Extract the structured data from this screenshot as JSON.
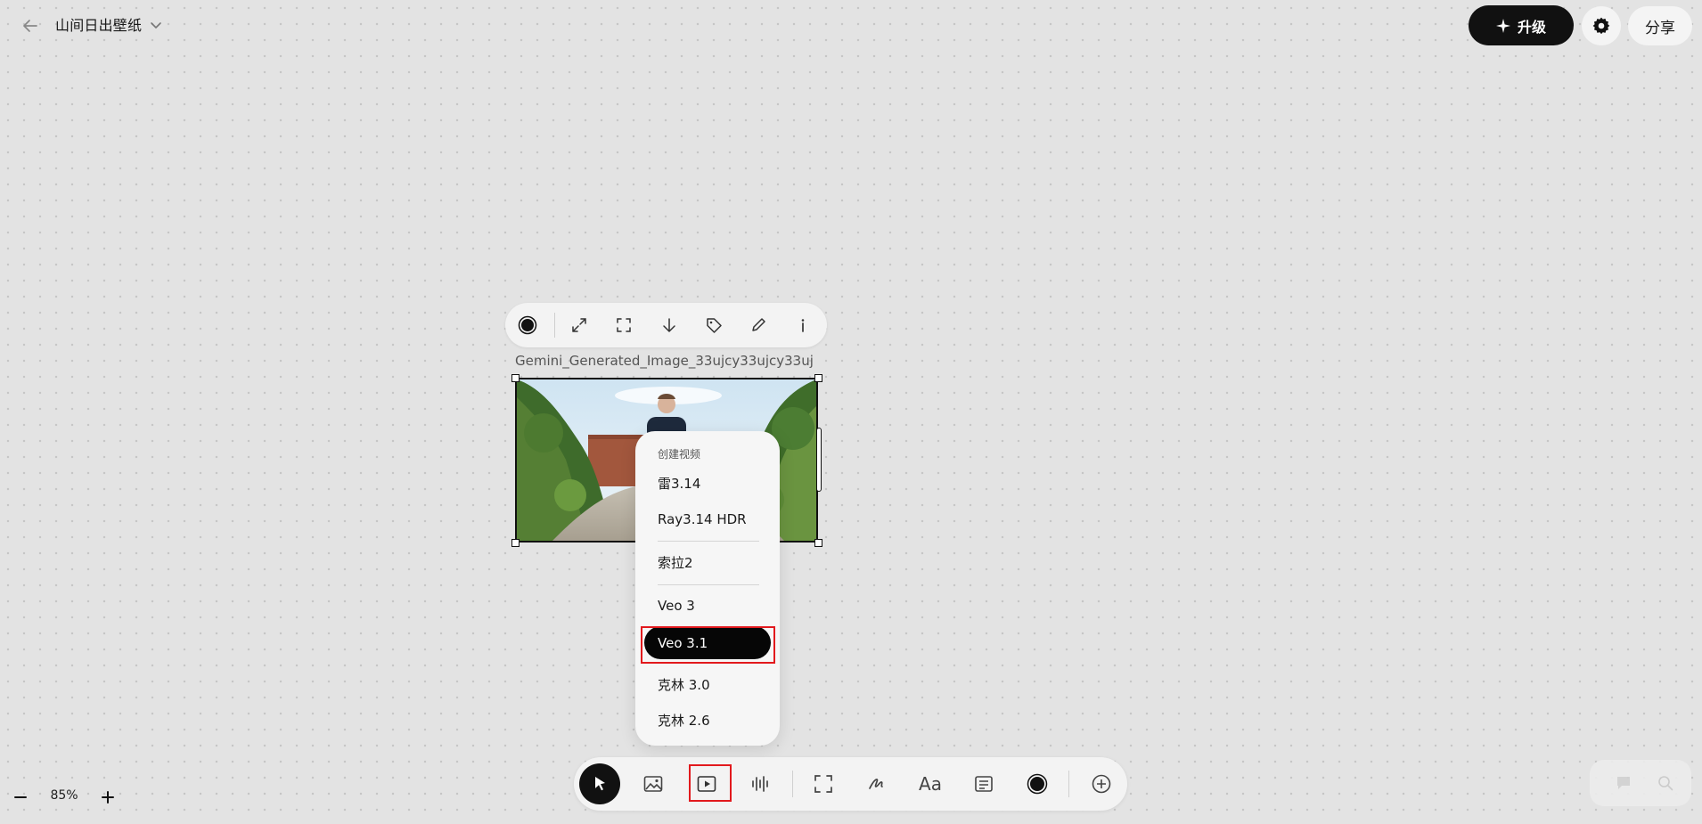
{
  "header": {
    "title": "山间日出壁纸",
    "upgrade_label": "升级",
    "share_label": "分享"
  },
  "canvas": {
    "image_filename": "Gemini_Generated_Image_33ujcy33ujcy33uj",
    "image_toolbar_icons": [
      "color-dot-icon",
      "expand-icon",
      "crop-frame-icon",
      "download-arrow-icon",
      "tag-icon",
      "pencil-icon",
      "info-icon"
    ]
  },
  "model_menu": {
    "header": "创建视频",
    "items": [
      {
        "label": "雷3.14"
      },
      {
        "label": "Ray3.14 HDR"
      },
      {
        "label": "索拉2"
      },
      {
        "label": "Veo 3"
      },
      {
        "label": "Veo 3.1",
        "selected": true
      },
      {
        "label": "克林 3.0"
      },
      {
        "label": "克林 2.6"
      }
    ]
  },
  "bottom_toolbar": {
    "tools": [
      "select-cursor-icon",
      "image-icon",
      "video-icon",
      "audio-waveform-icon",
      "frame-icon",
      "draw-pen-icon",
      "text-icon",
      "note-icon",
      "color-dot-icon",
      "add-icon"
    ],
    "text_tool_label": "Aa",
    "active_tool": "select"
  },
  "zoom": {
    "level": "85%"
  },
  "colors": {
    "accent": "#111111",
    "highlight_red": "#e2191d",
    "canvas_bg": "#e3e3e3"
  }
}
